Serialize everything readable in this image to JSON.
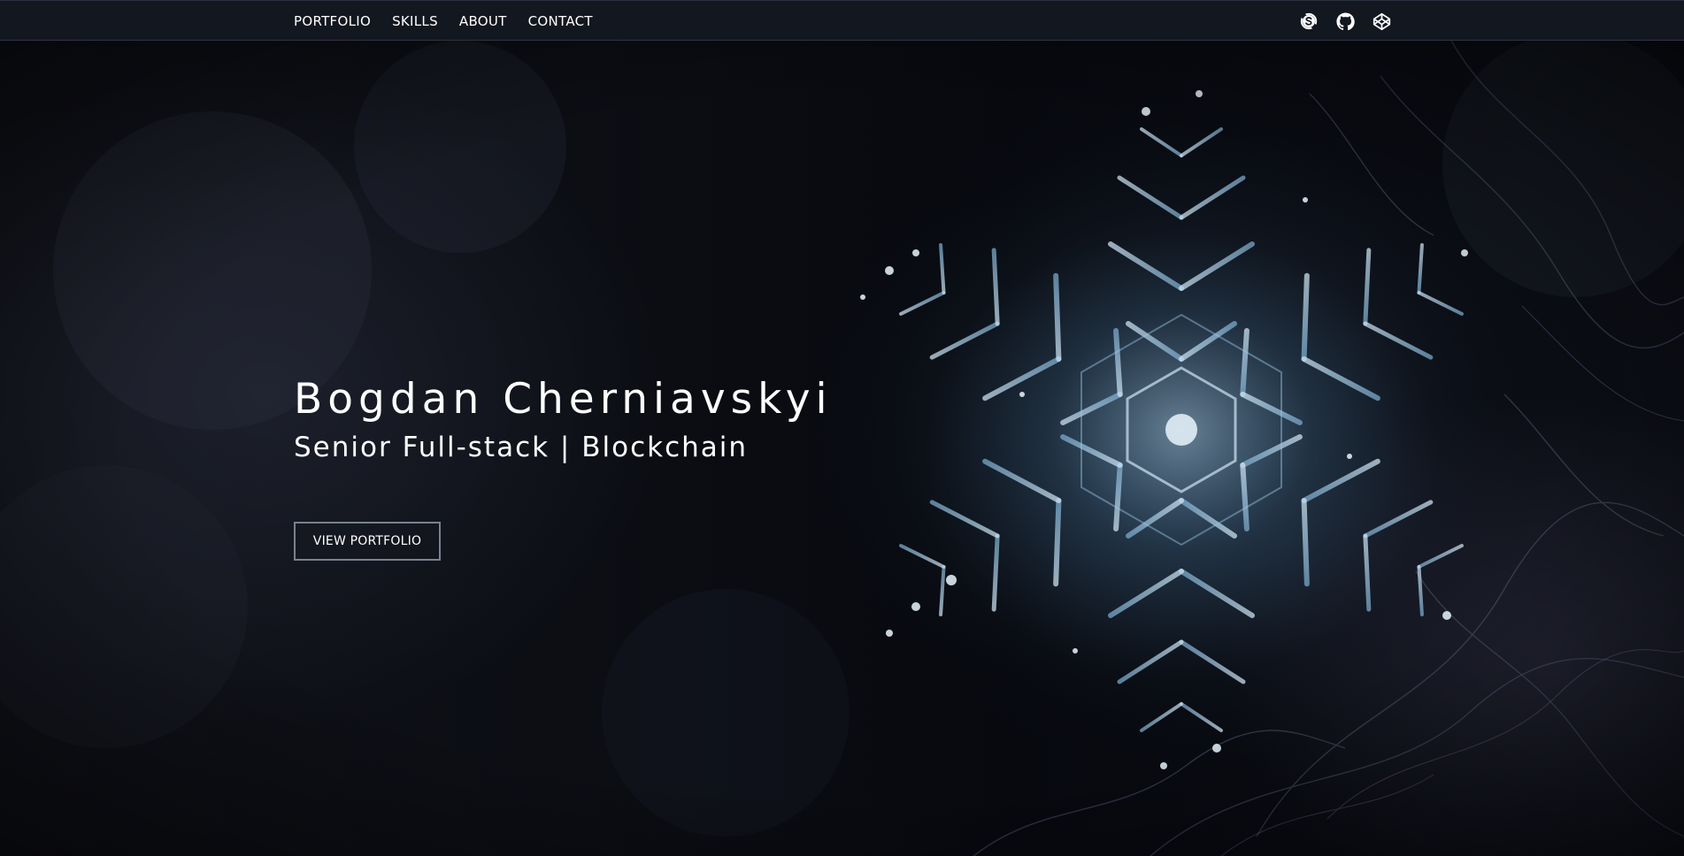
{
  "nav": {
    "links": [
      {
        "label": "PORTFOLIO"
      },
      {
        "label": "SKILLS"
      },
      {
        "label": "ABOUT"
      },
      {
        "label": "CONTACT"
      }
    ],
    "icons": [
      "skype-icon",
      "github-icon",
      "codepen-icon"
    ]
  },
  "hero": {
    "title": "Bogdan Cherniavskyi",
    "subtitle": "Senior Full-stack | Blockchain",
    "button_label": "VIEW PORTFOLIO",
    "background": "snowflake-macro-photo"
  },
  "colors": {
    "navbar_bg": "#131720",
    "text": "#ffffff",
    "button_border": "#7a8190",
    "snowflake_accent": "#9cc8e6"
  }
}
